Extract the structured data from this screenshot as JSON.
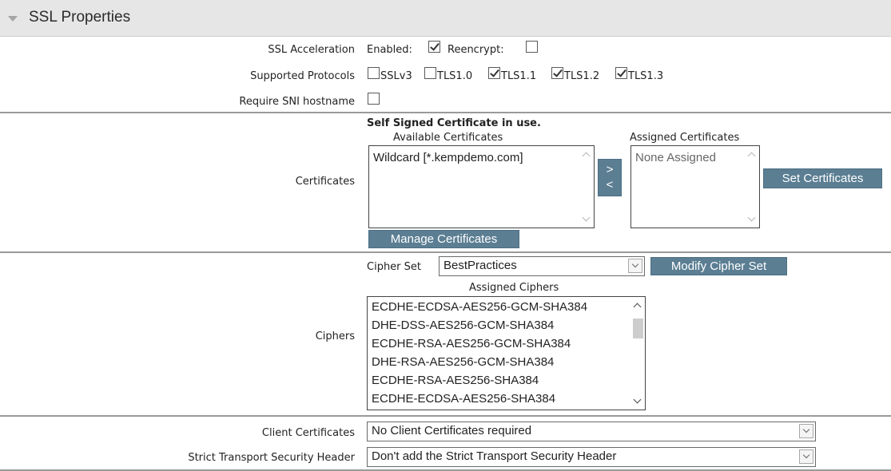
{
  "panel": {
    "title": "SSL Properties"
  },
  "ssl_acceleration": {
    "label": "SSL Acceleration",
    "enabled_label": "Enabled:",
    "enabled_checked": true,
    "reencrypt_label": "Reencrypt:",
    "reencrypt_checked": false
  },
  "protocols": {
    "label": "Supported Protocols",
    "items": [
      {
        "name": "SSLv3",
        "checked": false
      },
      {
        "name": "TLS1.0",
        "checked": false
      },
      {
        "name": "TLS1.1",
        "checked": true
      },
      {
        "name": "TLS1.2",
        "checked": true
      },
      {
        "name": "TLS1.3",
        "checked": true
      }
    ]
  },
  "sni": {
    "label": "Require SNI hostname",
    "checked": false
  },
  "certificates": {
    "label": "Certificates",
    "notice": "Self Signed Certificate in use.",
    "available_title": "Available Certificates",
    "available_items": [
      "Wildcard [*.kempdemo.com]"
    ],
    "assigned_title": "Assigned Certificates",
    "assigned_items": [
      "None Assigned"
    ],
    "move_right": ">",
    "move_left": "<",
    "set_button": "Set Certificates",
    "manage_button": "Manage Certificates"
  },
  "ciphers": {
    "label": "Ciphers",
    "cipher_set_label": "Cipher Set",
    "cipher_set_value": "BestPractices",
    "modify_button": "Modify Cipher Set",
    "assigned_title": "Assigned Ciphers",
    "items": [
      "ECDHE-ECDSA-AES256-GCM-SHA384",
      "DHE-DSS-AES256-GCM-SHA384",
      "ECDHE-RSA-AES256-GCM-SHA384",
      "DHE-RSA-AES256-GCM-SHA384",
      "ECDHE-RSA-AES256-SHA384",
      "ECDHE-ECDSA-AES256-SHA384"
    ]
  },
  "client_certificates": {
    "label": "Client Certificates",
    "value": "No Client Certificates required"
  },
  "hsts": {
    "label": "Strict Transport Security Header",
    "value": "Don't add the Strict Transport Security Header"
  }
}
